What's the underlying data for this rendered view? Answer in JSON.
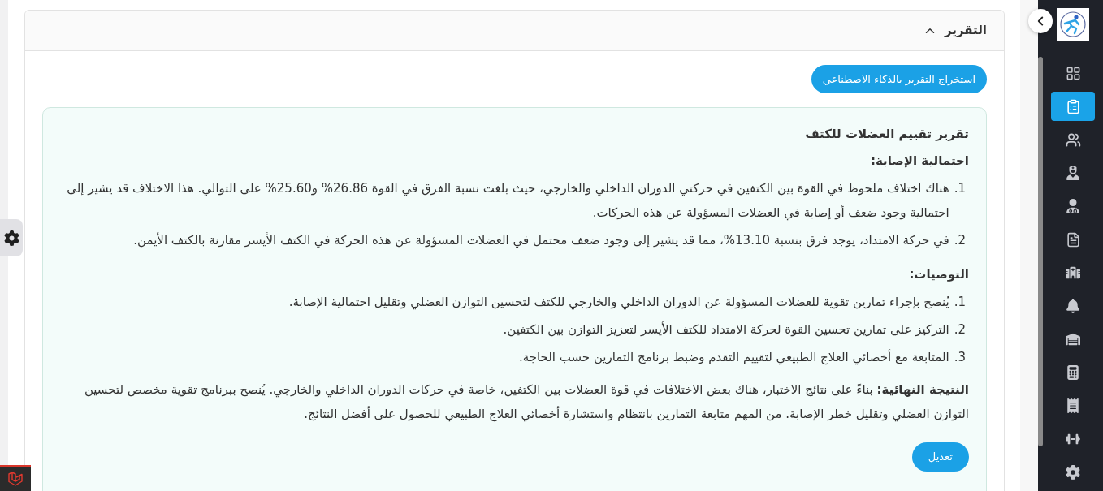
{
  "report_section": {
    "title": "التقرير",
    "expanded": true,
    "ai_button": "استخراج التقرير بالذكاء الاصطناعي",
    "report": {
      "title": "تقرير تقييم العضلات للكتف",
      "injury_risk": {
        "heading": "احتمالية الإصابة:",
        "items": [
          {
            "number": "1.",
            "text": "هناك اختلاف ملحوظ في القوة بين الكتفين في حركتي الدوران الداخلي والخارجي، حيث بلغت نسبة الفرق في القوة 26.86% و25.60% على التوالي. هذا الاختلاف قد يشير إلى احتمالية وجود ضعف أو إصابة في العضلات المسؤولة عن هذه الحركات."
          },
          {
            "number": "2.",
            "text": "في حركة الامتداد، يوجد فرق بنسبة 13.10%، مما قد يشير إلى وجود ضعف محتمل في العضلات المسؤولة عن هذه الحركة في الكتف الأيسر مقارنة بالكتف الأيمن."
          }
        ]
      },
      "recommendations": {
        "heading": "التوصيات:",
        "items": [
          {
            "number": "1.",
            "text": "يُنصح بإجراء تمارين تقوية للعضلات المسؤولة عن الدوران الداخلي والخارجي للكتف لتحسين التوازن العضلي وتقليل احتمالية الإصابة."
          },
          {
            "number": "2.",
            "text": "التركيز على تمارين تحسين القوة لحركة الامتداد للكتف الأيسر لتعزيز التوازن بين الكتفين."
          },
          {
            "number": "3.",
            "text": "المتابعة مع أخصائي العلاج الطبيعي لتقييم التقدم وضبط برنامج التمارين حسب الحاجة."
          }
        ]
      },
      "conclusion": "**النتيجة النهائية:** بناءً على نتائج الاختبار، هناك بعض الاختلافات في قوة العضلات بين الكتفين، خاصة في حركات الدوران الداخلي والخارجي. يُنصح ببرنامج تقوية مخصص لتحسين التوازن العضلي وتقليل خطر الإصابة. من المهم متابعة التمارين بانتظام واستشارة أخصائي العلاج الطبيعي للحصول على أفضل النتائج."
    },
    "edit_button": "تعديل"
  },
  "sidebar": {
    "items": [
      {
        "selected": false
      },
      {
        "selected": true
      },
      {
        "selected": false
      },
      {
        "selected": false
      },
      {
        "selected": false
      },
      {
        "selected": false
      },
      {
        "selected": false
      },
      {
        "selected": false
      },
      {
        "selected": false
      },
      {
        "selected": false
      },
      {
        "selected": false
      },
      {
        "selected": false
      },
      {
        "selected": false
      }
    ]
  }
}
